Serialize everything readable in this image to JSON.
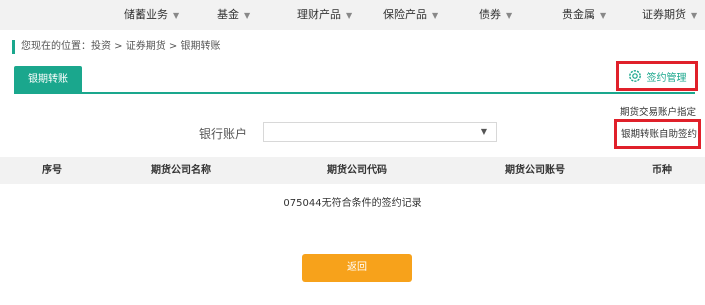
{
  "topnav": {
    "items": [
      {
        "label": "储蓄业务"
      },
      {
        "label": "基金"
      },
      {
        "label": "理财产品"
      },
      {
        "label": "保险产品"
      },
      {
        "label": "债券"
      },
      {
        "label": "贵金属"
      },
      {
        "label": "证券期货"
      }
    ]
  },
  "breadcrumb": {
    "text": "您现在的位置：投资 > 证券期货 > 银期转账"
  },
  "tabs": {
    "active_label": "银期转账"
  },
  "sign_management": {
    "label": "签约管理",
    "menu": [
      {
        "label": "期货交易账户指定"
      },
      {
        "label": "银期转账自助签约"
      }
    ]
  },
  "form": {
    "account_label": "银行账户",
    "account_value": ""
  },
  "table": {
    "headers": [
      "序号",
      "期货公司名称",
      "期货公司代码",
      "期货公司账号",
      "币种"
    ],
    "empty_message": "075044无符合条件的签约记录"
  },
  "actions": {
    "back_label": "返回"
  },
  "colors": {
    "accent": "#1aa78d",
    "highlight_border": "#e0202a",
    "button": "#f7a21b"
  }
}
